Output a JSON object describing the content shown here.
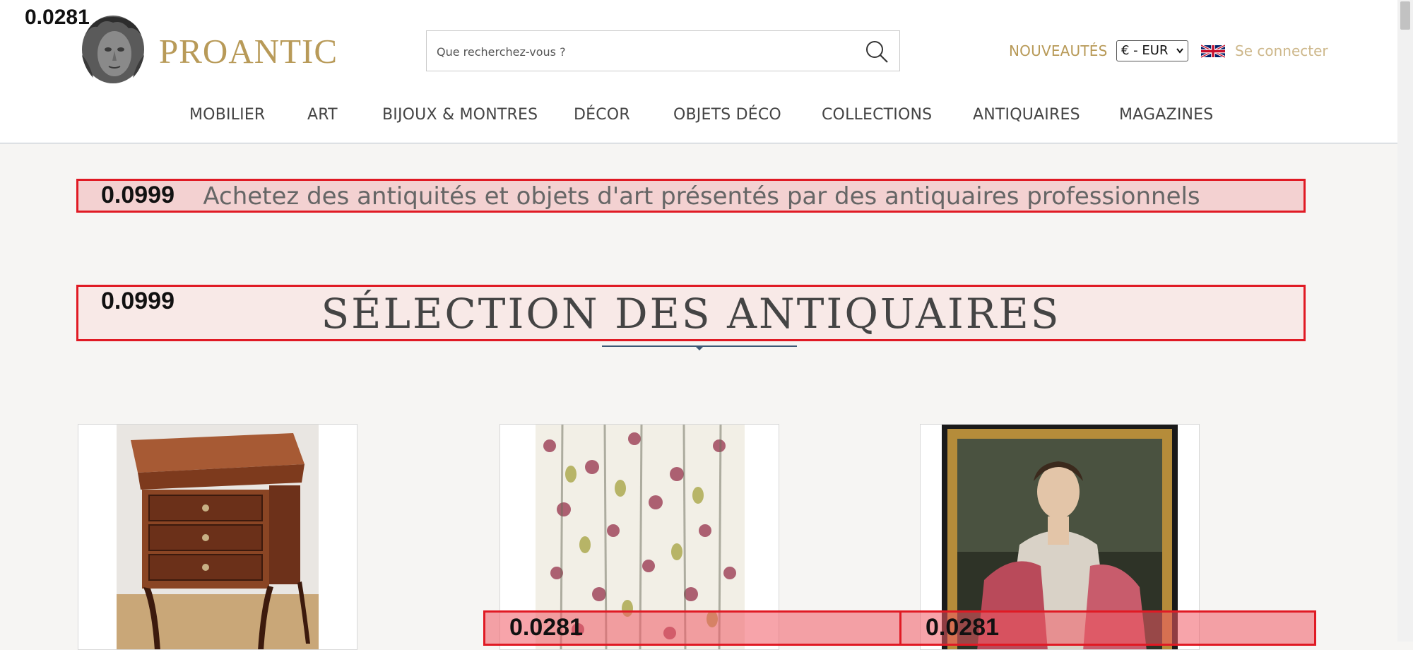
{
  "header": {
    "logo_text": "PROANTIC",
    "search_placeholder": "Que recherchez-vous ?",
    "nouveautes_label": "NOUVEAUTÉS",
    "currency_value": "€ - EUR",
    "login_label": "Se connecter"
  },
  "nav": {
    "items": [
      "MOBILIER",
      "ART",
      "BIJOUX & MONTRES",
      "DÉCOR",
      "OBJETS DÉCO",
      "COLLECTIONS",
      "ANTIQUAIRES",
      "MAGAZINES"
    ]
  },
  "main": {
    "tagline": "Achetez des antiquités et objets d'art présentés par des antiquaires professionnels",
    "section_title": "SÉLECTION DES ANTIQUAIRES"
  },
  "overlay_scores": {
    "top_left": "0.0281",
    "tagline": "0.0999",
    "section": "0.0999",
    "strip_left": "0.0281",
    "strip_right": "0.0281"
  },
  "icons": {
    "search": "search-icon",
    "flag": "uk-flag-icon",
    "logo": "sculpted-head-logo"
  },
  "colors": {
    "brand_gold": "#b89a58",
    "highlight_red": "#e01a24",
    "nav_text": "#444444"
  }
}
